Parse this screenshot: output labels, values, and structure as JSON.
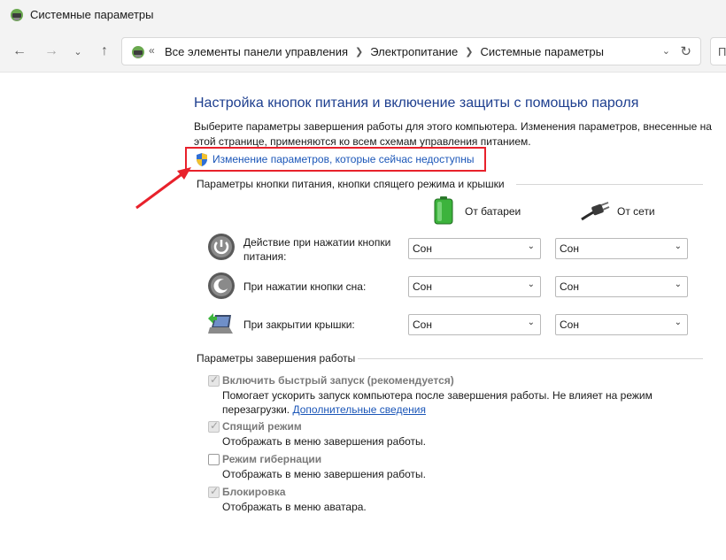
{
  "window": {
    "title": "Системные параметры"
  },
  "nav": {
    "back_icon": "arrow-left-icon",
    "forward_icon": "arrow-right-icon",
    "recent_icon": "chevron-down-icon",
    "up_icon": "arrow-up-icon",
    "refresh_icon": "refresh-icon"
  },
  "address": {
    "overflow": "«",
    "breadcrumbs": [
      "Все элементы панели управления",
      "Электропитание",
      "Системные параметры"
    ]
  },
  "main": {
    "title": "Настройка кнопок питания и включение защиты с помощью пароля",
    "description": "Выберите параметры завершения работы для этого компьютера. Изменения параметров, внесенные на этой странице, применяются ко всем схемам управления питанием.",
    "change_settings_link": "Изменение параметров, которые сейчас недоступны"
  },
  "buttons_section": {
    "header": "Параметры кнопки питания, кнопки спящего режима и крышки",
    "col_battery": "От батареи",
    "col_ac": "От сети",
    "rows": [
      {
        "label": "Действие при нажатии кнопки питания:",
        "battery": "Сон",
        "ac": "Сон"
      },
      {
        "label": "При нажатии кнопки сна:",
        "battery": "Сон",
        "ac": "Сон"
      },
      {
        "label": "При закрытии крышки:",
        "battery": "Сон",
        "ac": "Сон"
      }
    ]
  },
  "shutdown_section": {
    "header": "Параметры завершения работы",
    "options": [
      {
        "title": "Включить быстрый запуск (рекомендуется)",
        "desc_line1": "Помогает ускорить запуск компьютера после завершения работы. Не влияет на режим",
        "desc_line2": "перезагрузки.",
        "link": "Дополнительные сведения",
        "checked": true
      },
      {
        "title": "Спящий режим",
        "desc": "Отображать в меню завершения работы.",
        "checked": true
      },
      {
        "title": "Режим гибернации",
        "desc": "Отображать в меню завершения работы.",
        "checked": false
      },
      {
        "title": "Блокировка",
        "desc": "Отображать в меню аватара.",
        "checked": true
      }
    ]
  },
  "colors": {
    "title_blue": "#1e3f8f",
    "link_blue": "#1b56b8",
    "highlight_red": "#e8212b"
  }
}
